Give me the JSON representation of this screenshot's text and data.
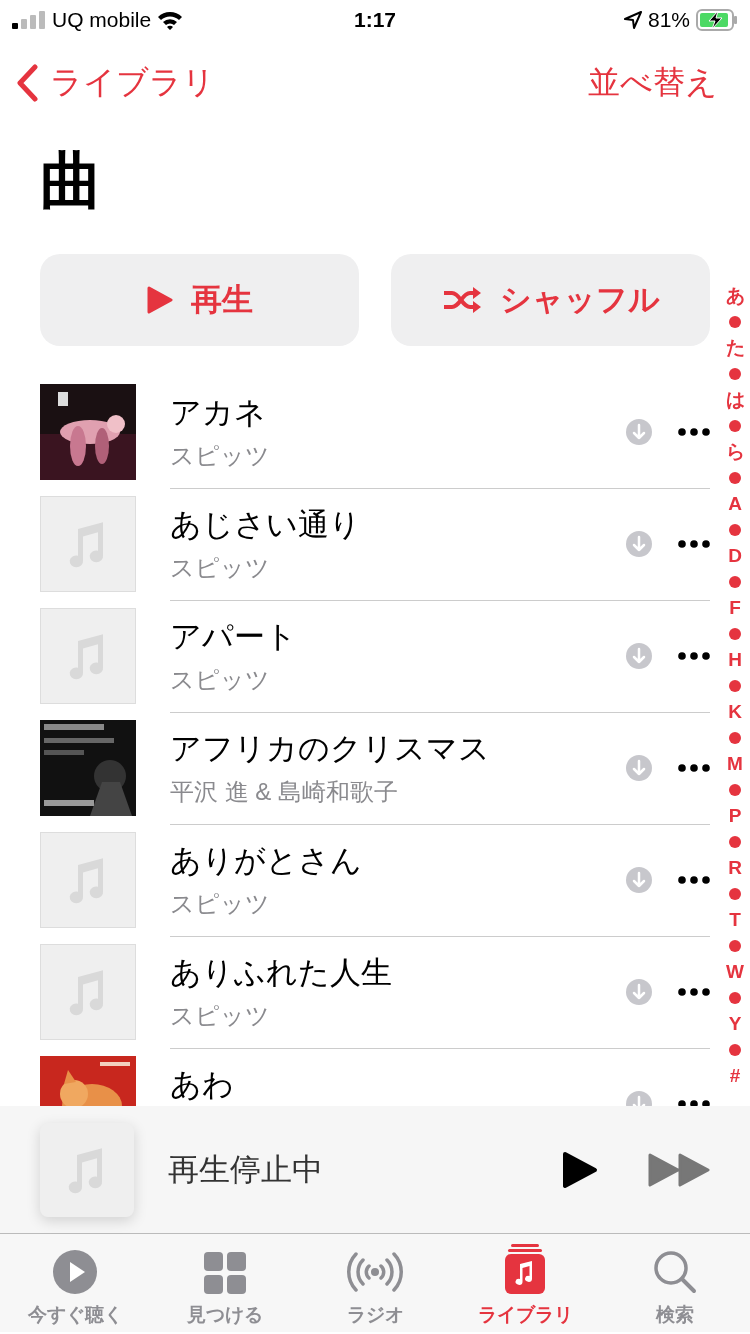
{
  "status_bar": {
    "carrier": "UQ mobile",
    "time": "1:17",
    "battery": "81%"
  },
  "nav": {
    "back": "ライブラリ",
    "action": "並べ替え"
  },
  "title": "曲",
  "buttons": [
    {
      "kind": "play",
      "label": "再生"
    },
    {
      "kind": "shuffle",
      "label": "シャッフル"
    }
  ],
  "songs": [
    {
      "title": "アカネ",
      "artist": "スピッツ"
    },
    {
      "title": "あじさい通り",
      "artist": "スピッツ",
      "artwork": {
        "kind": "placeholder"
      }
    },
    {
      "title": "アパート",
      "artist": "スピッツ",
      "artwork": {
        "kind": "placeholder"
      }
    },
    {
      "title": "アフリカのクリスマス",
      "artist": "平沢 進 & 島崎和歌子"
    },
    {
      "title": "ありがとさん",
      "artist": "スピッツ",
      "artwork": {
        "kind": "placeholder"
      }
    },
    {
      "title": "ありふれた人生",
      "artist": "スピッツ",
      "artwork": {
        "kind": "placeholder"
      }
    },
    {
      "title": "あわ"
    }
  ],
  "index": [
    "あ",
    "た",
    "は",
    "ら",
    "A",
    "D",
    "F",
    "H",
    "K",
    "M",
    "P",
    "R",
    "T",
    "W",
    "Y",
    "#"
  ],
  "mini_player": {
    "status": "再生停止中"
  },
  "tabs": [
    {
      "kind": "listen",
      "label": "今すぐ聴く",
      "selected": false
    },
    {
      "kind": "browse",
      "label": "見つける",
      "selected": false
    },
    {
      "kind": "radio",
      "label": "ラジオ",
      "selected": false
    },
    {
      "kind": "library",
      "label": "ライブラリ",
      "selected": true
    },
    {
      "kind": "search",
      "label": "検索",
      "selected": false
    }
  ]
}
